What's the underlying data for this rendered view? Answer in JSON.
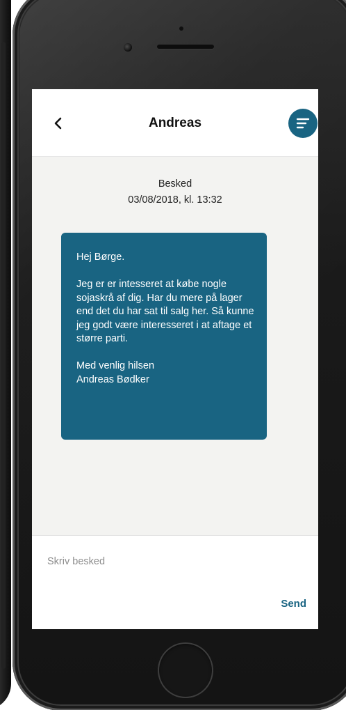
{
  "header": {
    "title": "Andreas",
    "back_icon": "chevron-left-icon",
    "menu_icon": "filter-lines-icon"
  },
  "message": {
    "label": "Besked",
    "timestamp": "03/08/2018, kl. 13:32",
    "greeting": "Hej Børge.",
    "body": "Jeg er er intesseret at købe nogle sojaskrå af dig. Har du mere på lager end det du har sat til salg her. Så kunne jeg godt være interesseret i at aftage et større parti.",
    "closing": "Med venlig hilsen",
    "signature": "Andreas Bødker"
  },
  "composer": {
    "placeholder": "Skriv besked",
    "send_label": "Send"
  },
  "colors": {
    "accent": "#196482",
    "background": "#f3f3f1"
  }
}
